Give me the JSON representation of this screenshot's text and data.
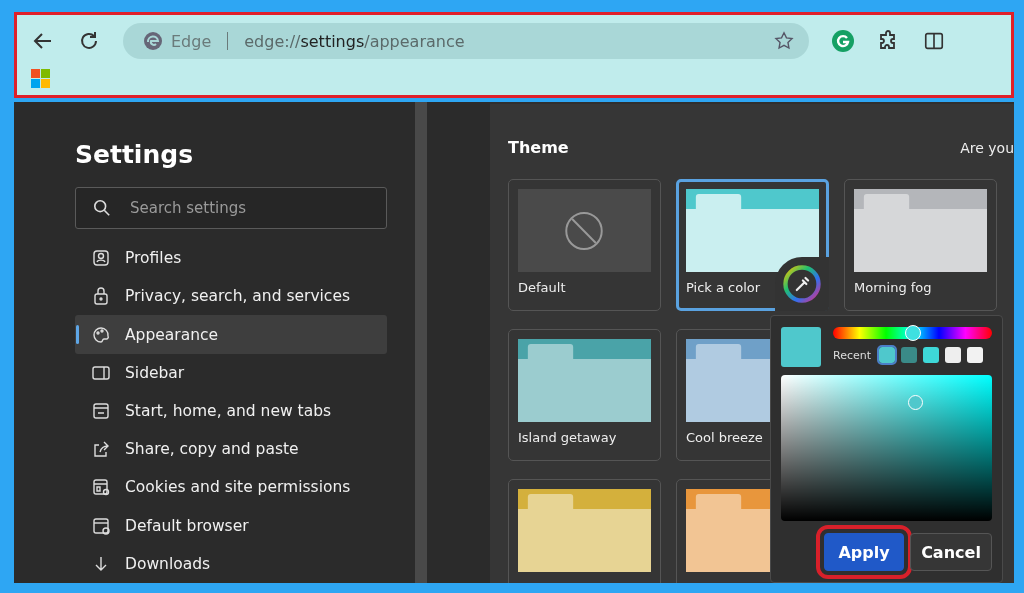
{
  "toolbar": {
    "highlighted": true,
    "brand": "Edge",
    "address": "edge://**settings**/appearance"
  },
  "sidebar": {
    "title": "Settings",
    "search": {
      "placeholder": "Search settings"
    },
    "items": [
      {
        "label": "Profiles",
        "selected": false
      },
      {
        "label": "Privacy, search, and services",
        "selected": false
      },
      {
        "label": "Appearance",
        "selected": true
      },
      {
        "label": "Sidebar",
        "selected": false
      },
      {
        "label": "Start, home, and new tabs",
        "selected": false
      },
      {
        "label": "Share, copy and paste",
        "selected": false
      },
      {
        "label": "Cookies and site permissions",
        "selected": false
      },
      {
        "label": "Default browser",
        "selected": false
      },
      {
        "label": "Downloads",
        "selected": false
      }
    ]
  },
  "content": {
    "heading": "Theme",
    "side_text": "Are you",
    "themes": [
      {
        "kind": "default",
        "label": "Default",
        "selected": false
      },
      {
        "kind": "custom",
        "label": "Pick a color",
        "selected": true,
        "color": "#4fc8cc"
      },
      {
        "kind": "preset",
        "label": "Morning fog",
        "selected": false,
        "color": "#b4b6ba"
      },
      {
        "kind": "preset",
        "label": "Island getaway",
        "selected": false,
        "color": "#4aa3a8"
      },
      {
        "kind": "preset",
        "label": "Cool breeze",
        "selected": false,
        "color": "#6fa0c8"
      },
      {
        "kind": "preset",
        "selected": false,
        "color": "#d4b03c"
      },
      {
        "kind": "preset",
        "selected": false,
        "color": "#e8963c"
      }
    ]
  },
  "picker": {
    "hue": {
      "level": 0.5
    },
    "recent_label": "Recent",
    "recent": [
      {
        "color": "#4fc8cc",
        "selected": true
      },
      {
        "color": "#3a8a88",
        "selected": false
      },
      {
        "color": "#3ed8d8",
        "selected": false
      },
      {
        "color": "#eeeeee",
        "selected": false
      },
      {
        "color": "#f2f2f2",
        "selected": false
      }
    ],
    "buttons": [
      {
        "label": "Apply",
        "kind": "primary",
        "highlighted": true
      },
      {
        "label": "Cancel",
        "kind": "secondary",
        "highlighted": false
      }
    ]
  }
}
